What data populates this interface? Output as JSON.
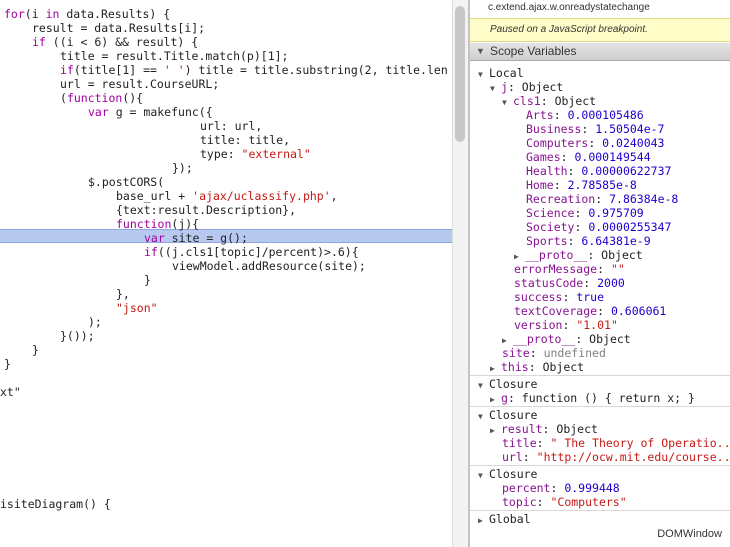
{
  "editor": {
    "lines": [
      {
        "text": "for(i in data.Results) {",
        "indent": 0
      },
      {
        "text": "result = data.Results[i];",
        "indent": 4
      },
      {
        "text": "if ((i < 6) && result) {",
        "indent": 4
      },
      {
        "text": "title = result.Title.match(p)[1];",
        "indent": 8
      },
      {
        "text": "if(title[1] == ' ') title = title.substring(2, title.len",
        "indent": 8
      },
      {
        "text": "url = result.CourseURL;",
        "indent": 8
      },
      {
        "text": "(function(){",
        "indent": 8
      },
      {
        "text": "var g = makefunc({",
        "indent": 12
      },
      {
        "text": "url: url,",
        "indent": 28
      },
      {
        "text": "title: title,",
        "indent": 28
      },
      {
        "text": "type: \"external\"",
        "indent": 28
      },
      {
        "text": "});",
        "indent": 24
      },
      {
        "text": "$.postCORS(",
        "indent": 12
      },
      {
        "text": "base_url + 'ajax/uclassify.php',",
        "indent": 16
      },
      {
        "text": "{text:result.Description},",
        "indent": 16
      },
      {
        "text": "function(j){",
        "indent": 16
      },
      {
        "text": "var site = g();",
        "indent": 20
      },
      {
        "text": "if((j.cls1[topic]/percent)>.6){",
        "indent": 20
      },
      {
        "text": "viewModel.addResource(site);",
        "indent": 24
      },
      {
        "text": "}",
        "indent": 20
      },
      {
        "text": "},",
        "indent": 16
      },
      {
        "text": "\"json\"",
        "indent": 16
      },
      {
        "text": ");",
        "indent": 12
      },
      {
        "text": "}());",
        "indent": 8
      },
      {
        "text": "}",
        "indent": 4
      },
      {
        "text": "}",
        "indent": 0
      },
      {
        "text": "",
        "indent": 0
      },
      {
        "text": "xt\"",
        "indent": -1
      },
      {
        "text": "",
        "indent": 0
      },
      {
        "text": "",
        "indent": 0
      },
      {
        "text": "",
        "indent": 0
      },
      {
        "text": "",
        "indent": 0
      },
      {
        "text": "",
        "indent": 0
      },
      {
        "text": "",
        "indent": 0
      },
      {
        "text": "",
        "indent": 0
      },
      {
        "text": "isiteDiagram() {",
        "indent": -1
      }
    ],
    "highlighted_line": 17
  },
  "sidebar": {
    "call_frame": "c.extend.ajax.w.onreadystatechange",
    "paused_message": "Paused on a JavaScript breakpoint.",
    "scope_header": "Scope Variables",
    "domwindow_label": "DOMWindow"
  },
  "scope": [
    {
      "depth": 0,
      "toggle": "down",
      "label": "Local"
    },
    {
      "depth": 1,
      "toggle": "down",
      "key": "j",
      "value": "Object",
      "kind": "obj"
    },
    {
      "depth": 2,
      "toggle": "down",
      "key": "cls1",
      "value": "Object",
      "kind": "obj"
    },
    {
      "depth": 3,
      "key": "Arts",
      "value": "0.000105486",
      "kind": "num"
    },
    {
      "depth": 3,
      "key": "Business",
      "value": "1.50504e-7",
      "kind": "num"
    },
    {
      "depth": 3,
      "key": "Computers",
      "value": "0.0240043",
      "kind": "num"
    },
    {
      "depth": 3,
      "key": "Games",
      "value": "0.000149544",
      "kind": "num"
    },
    {
      "depth": 3,
      "key": "Health",
      "value": "0.00000622737",
      "kind": "num"
    },
    {
      "depth": 3,
      "key": "Home",
      "value": "2.78585e-8",
      "kind": "num"
    },
    {
      "depth": 3,
      "key": "Recreation",
      "value": "7.86384e-8",
      "kind": "num"
    },
    {
      "depth": 3,
      "key": "Science",
      "value": "0.975709",
      "kind": "num"
    },
    {
      "depth": 3,
      "key": "Society",
      "value": "0.0000255347",
      "kind": "num"
    },
    {
      "depth": 3,
      "key": "Sports",
      "value": "6.64381e-9",
      "kind": "num"
    },
    {
      "depth": 3,
      "toggle": "right",
      "key": "__proto__",
      "value": "Object",
      "kind": "obj",
      "shift": -1
    },
    {
      "depth": 2,
      "key": "errorMessage",
      "value": "\"\"",
      "kind": "str"
    },
    {
      "depth": 2,
      "key": "statusCode",
      "value": "2000",
      "kind": "num"
    },
    {
      "depth": 2,
      "key": "success",
      "value": "true",
      "kind": "num"
    },
    {
      "depth": 2,
      "key": "textCoverage",
      "value": "0.606061",
      "kind": "num"
    },
    {
      "depth": 2,
      "key": "version",
      "value": "\"1.01\"",
      "kind": "str"
    },
    {
      "depth": 2,
      "toggle": "right",
      "key": "__proto__",
      "value": "Object",
      "kind": "obj",
      "shift": -1
    },
    {
      "depth": 1,
      "key": "site",
      "value": "undefined",
      "kind": "undef"
    },
    {
      "depth": 1,
      "toggle": "right",
      "key": "this",
      "value": "Object",
      "kind": "obj",
      "shift": -1
    },
    {
      "sep": true
    },
    {
      "depth": 0,
      "toggle": "down",
      "label": "Closure"
    },
    {
      "depth": 1,
      "toggle": "right",
      "key": "g",
      "value": "function () { return x; }",
      "kind": "obj",
      "shift": -1
    },
    {
      "sep": true
    },
    {
      "depth": 0,
      "toggle": "down",
      "label": "Closure"
    },
    {
      "depth": 1,
      "toggle": "right",
      "key": "result",
      "value": "Object",
      "kind": "obj",
      "shift": -1
    },
    {
      "depth": 1,
      "key": "title",
      "value": "\" The Theory of Operatio...",
      "kind": "str"
    },
    {
      "depth": 1,
      "key": "url",
      "value": "\"http://ocw.mit.edu/course...",
      "kind": "str"
    },
    {
      "sep": true
    },
    {
      "depth": 0,
      "toggle": "down",
      "label": "Closure"
    },
    {
      "depth": 1,
      "key": "percent",
      "value": "0.999448",
      "kind": "num"
    },
    {
      "depth": 1,
      "key": "topic",
      "value": "\"Computers\"",
      "kind": "str"
    },
    {
      "sep": true
    },
    {
      "depth": 0,
      "toggle": "right",
      "label": "Global"
    }
  ]
}
